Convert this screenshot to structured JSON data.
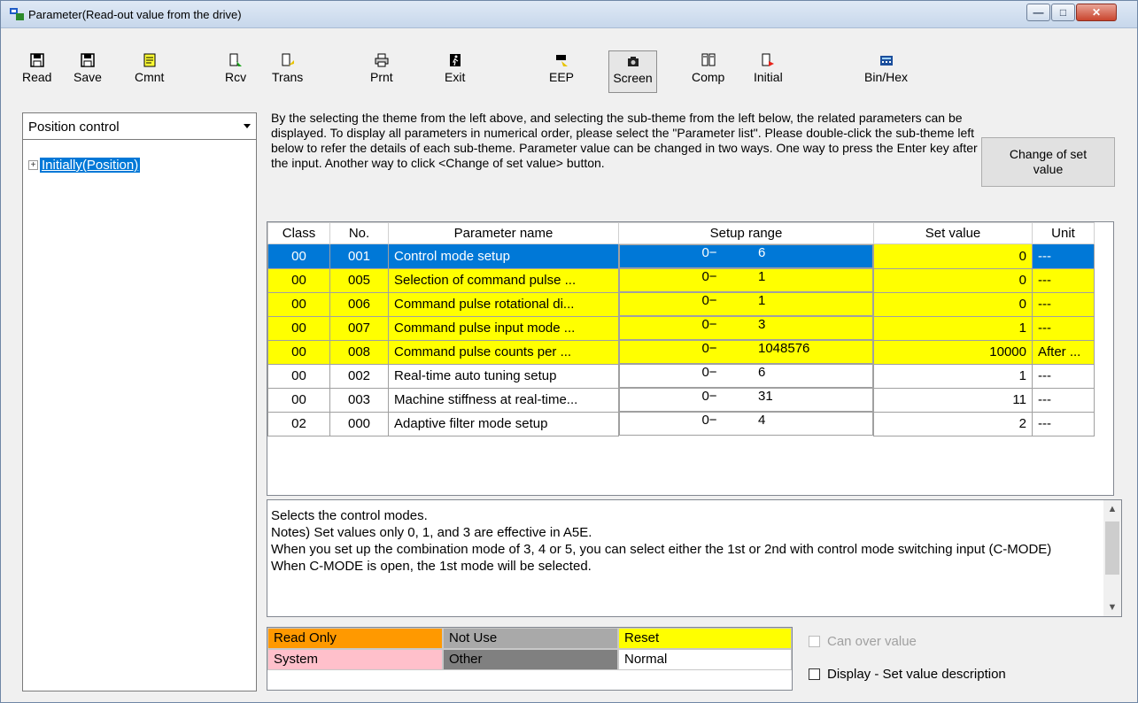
{
  "window": {
    "title": "Parameter(Read-out value from the drive)"
  },
  "toolbar": {
    "buttons": [
      {
        "label": "Read",
        "icon": "floppy-disk-icon"
      },
      {
        "label": "Save",
        "icon": "floppy-disk-icon"
      },
      {
        "label": "Cmnt",
        "icon": "note-icon"
      },
      {
        "label": "Rcv",
        "icon": "receive-icon"
      },
      {
        "label": "Trans",
        "icon": "transmit-icon"
      },
      {
        "label": "Prnt",
        "icon": "printer-icon"
      },
      {
        "label": "Exit",
        "icon": "exit-door-icon"
      },
      {
        "label": "EEP",
        "icon": "eeprom-icon"
      },
      {
        "label": "Screen",
        "icon": "camera-icon"
      },
      {
        "label": "Comp",
        "icon": "compare-icon"
      },
      {
        "label": "Initial",
        "icon": "initial-icon"
      },
      {
        "label": "Bin/Hex",
        "icon": "calculator-icon"
      }
    ]
  },
  "left": {
    "theme_select": "Position control",
    "tree_item": "Initially(Position)"
  },
  "description": "By the selecting the theme from the left above, and selecting the sub-theme from the left below, the related parameters can be displayed. To display all parameters in numerical order, please select the \"Parameter list\". Please double-click the sub-theme left below to refer the details of each sub-theme. Parameter value can be changed in two ways. One way to press the Enter key after the input. Another way to click <Change of set value> button.",
  "change_button": "Change of set value",
  "table": {
    "headers": [
      "Class",
      "No.",
      "Parameter name",
      "Setup range",
      "Set value",
      "Unit"
    ],
    "rows": [
      {
        "class": "00",
        "no": "001",
        "name": "Control mode setup",
        "range_lo": "0−",
        "range_hi": "6",
        "set": "0",
        "unit": "---",
        "style": "sel"
      },
      {
        "class": "00",
        "no": "005",
        "name": "Selection of command pulse ...",
        "range_lo": "0−",
        "range_hi": "1",
        "set": "0",
        "unit": "---",
        "style": "yellow"
      },
      {
        "class": "00",
        "no": "006",
        "name": "Command pulse rotational di...",
        "range_lo": "0−",
        "range_hi": "1",
        "set": "0",
        "unit": "---",
        "style": "yellow"
      },
      {
        "class": "00",
        "no": "007",
        "name": "Command pulse input mode ...",
        "range_lo": "0−",
        "range_hi": "3",
        "set": "1",
        "unit": "---",
        "style": "yellow"
      },
      {
        "class": "00",
        "no": "008",
        "name": "Command pulse counts per ...",
        "range_lo": "0−",
        "range_hi": "1048576",
        "set": "10000",
        "unit": "After ...",
        "style": "yellow"
      },
      {
        "class": "00",
        "no": "002",
        "name": "Real-time auto tuning setup",
        "range_lo": "0−",
        "range_hi": "6",
        "set": "1",
        "unit": "---",
        "style": "white"
      },
      {
        "class": "00",
        "no": "003",
        "name": "Machine stiffness at real-time...",
        "range_lo": "0−",
        "range_hi": "31",
        "set": "11",
        "unit": "---",
        "style": "white"
      },
      {
        "class": "02",
        "no": "000",
        "name": "Adaptive filter mode setup",
        "range_lo": "0−",
        "range_hi": "4",
        "set": "2",
        "unit": "---",
        "style": "white"
      }
    ]
  },
  "memo": [
    "Selects the control modes.",
    "Notes) Set values only 0, 1, and 3 are effective in A5E.",
    "When you set up the combination mode of 3, 4 or 5, you can select either the 1st or 2nd with control mode switching input (C-MODE)",
    "When C-MODE is open, the 1st mode will be selected."
  ],
  "legend": {
    "read_only": "Read Only",
    "not_use": "Not Use",
    "reset": "Reset",
    "system": "System",
    "other": "Other",
    "normal": "Normal"
  },
  "colors": {
    "read_only": "#ff9900",
    "not_use": "#a9a9a9",
    "reset": "#ffff00",
    "system": "#ffc0cb",
    "other": "#808080",
    "normal": "#ffffff",
    "selection": "#0078d7"
  },
  "checkboxes": {
    "can_over_value": "Can over value",
    "display_set_value_description": "Display - Set value description"
  }
}
